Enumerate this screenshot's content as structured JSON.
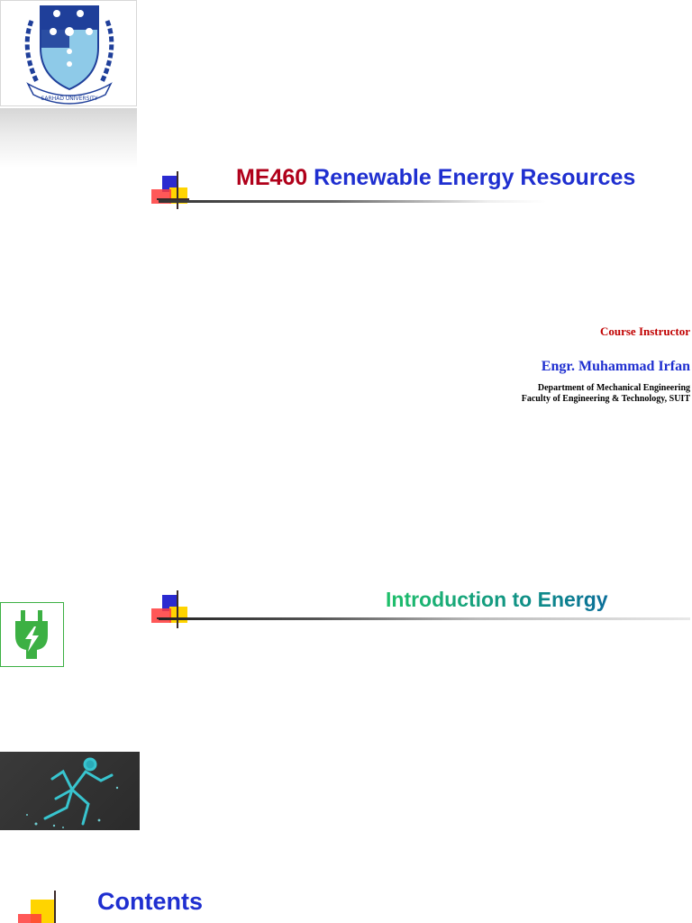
{
  "slide1": {
    "logo_icon": "university-crest-logo",
    "logo_text": "SARHAD UNIVERSITY",
    "title_code": "ME460",
    "title_text": "Renewable Energy Resources",
    "instructor_label": "Course Instructor",
    "instructor_name": "Engr. Muhammad Irfan",
    "department": "Department of Mechanical Engineering",
    "faculty": "Faculty of Engineering & Technology, SUIT"
  },
  "slide2": {
    "title": "Introduction to Energy",
    "icon": "power-plug-icon",
    "image_icon": "running-figure-image"
  },
  "slide3": {
    "title": "Contents"
  },
  "colors": {
    "title_blue": "#1f2fd0",
    "code_red": "#b0001a",
    "label_red": "#c00000",
    "green": "#3cb043"
  }
}
